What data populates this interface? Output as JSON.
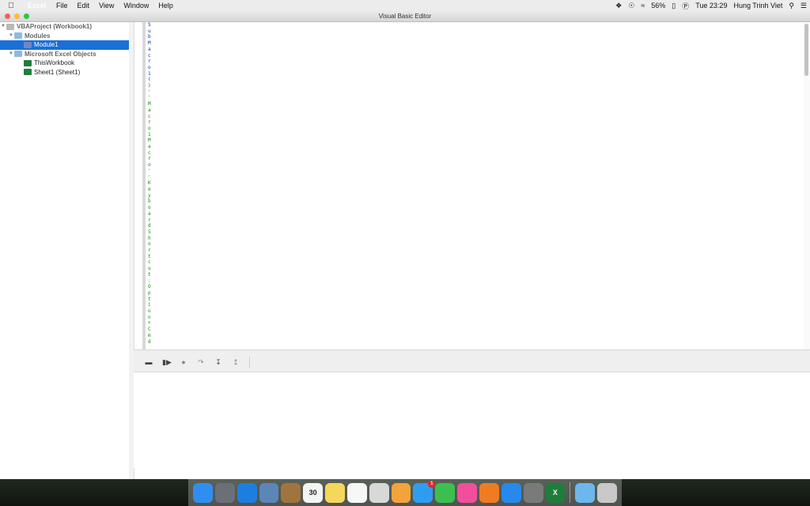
{
  "menubar": {
    "apple": "",
    "items": [
      "Excel",
      "File",
      "Edit",
      "View",
      "Window",
      "Help"
    ],
    "battery": "56%",
    "clock": "Tue 23:29",
    "user": "Hung Trinh Viet"
  },
  "window": {
    "title": "Visual Basic Editor"
  },
  "project_tree": {
    "root": "VBAProject (Workbook1)",
    "modules_folder": "Modules",
    "module1": "Module1",
    "objects_folder": "Microsoft Excel Objects",
    "thisworkbook": "ThisWorkbook",
    "sheet1": "Sheet1 (Sheet1)"
  },
  "code_chars": {
    "blue": [
      "S",
      "u",
      "b",
      "M",
      "a",
      "c",
      "r",
      "o",
      "1",
      "(",
      ")",
      "'"
    ],
    "green": [
      " ",
      "'",
      "M",
      "a",
      "c",
      "r",
      "o",
      "1",
      "M",
      "a",
      "c",
      "r",
      "o",
      "'",
      " ",
      "'",
      "K",
      "e",
      "y",
      "b",
      "o",
      "a",
      "r",
      "d",
      "S",
      "h",
      "o",
      "r",
      "t",
      "c",
      "u",
      "t",
      ":",
      "O",
      "p",
      "t",
      "i",
      "o",
      "n",
      "+",
      "C",
      "m",
      "d"
    ]
  },
  "toolbar": {
    "icons": [
      "stop-icon",
      "run-icon",
      "breakpoint-icon",
      "step-over-icon",
      "step-into-icon",
      "step-out-icon"
    ]
  },
  "dock": {
    "apps": [
      {
        "name": "finder-icon",
        "color": "#2f8ff0"
      },
      {
        "name": "launchpad-icon",
        "color": "#6a6f78"
      },
      {
        "name": "safari-icon",
        "color": "#1c7fe0"
      },
      {
        "name": "preview-icon",
        "color": "#5b86b8"
      },
      {
        "name": "contacts-icon",
        "color": "#a0743f"
      },
      {
        "name": "calendar-icon",
        "color": "#f4f4f4",
        "label": "30"
      },
      {
        "name": "notes-icon",
        "color": "#f5d85a"
      },
      {
        "name": "reminders-icon",
        "color": "#f7f7f7"
      },
      {
        "name": "photo-booth-icon",
        "color": "#d8d8d8"
      },
      {
        "name": "photos-icon",
        "color": "#f2a33a"
      },
      {
        "name": "messages-icon",
        "color": "#2e9cf0",
        "badge": "1"
      },
      {
        "name": "facetime-icon",
        "color": "#3bbf4e"
      },
      {
        "name": "itunes-icon",
        "color": "#f04f9b"
      },
      {
        "name": "ibooks-icon",
        "color": "#f07b21"
      },
      {
        "name": "app-store-icon",
        "color": "#2789ee"
      },
      {
        "name": "system-preferences-icon",
        "color": "#7a7a7a"
      },
      {
        "name": "excel-icon",
        "color": "#1f7d3c",
        "label": "X"
      },
      {
        "name": "downloads-folder-icon",
        "color": "#6db7ee"
      },
      {
        "name": "trash-icon",
        "color": "#c9c9c9"
      }
    ]
  }
}
